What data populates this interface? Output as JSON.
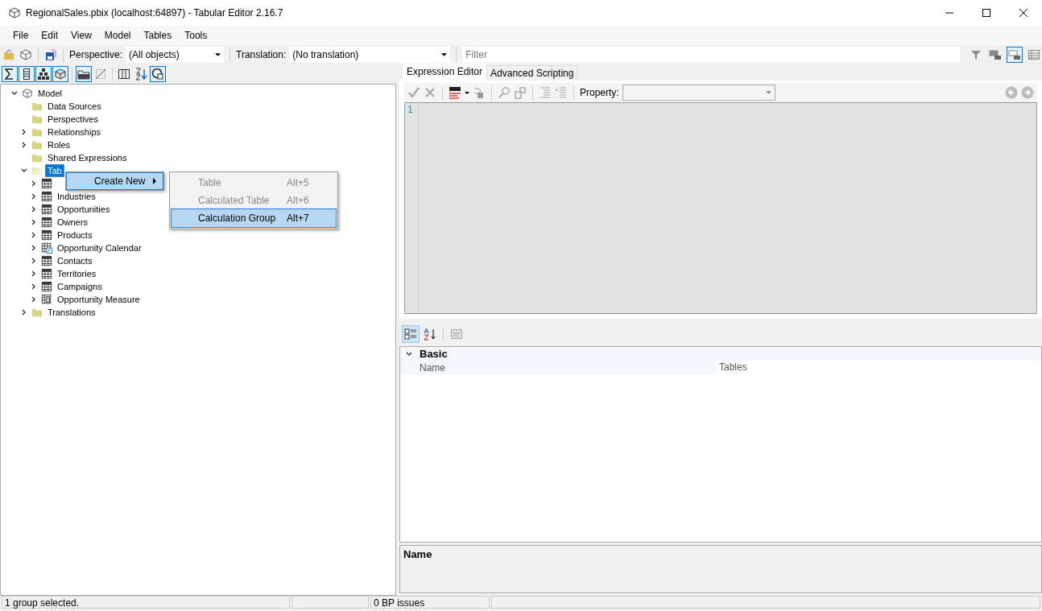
{
  "window": {
    "title": "RegionalSales.pbix (localhost:64897) - Tabular Editor 2.16.7"
  },
  "menu_bar": [
    "File",
    "Edit",
    "View",
    "Model",
    "Tables",
    "Tools"
  ],
  "toolbar": {
    "perspective_label": "Perspective:",
    "perspective": "(All objects)",
    "translation_label": "Translation:",
    "translation": "(No translation)",
    "filter": {
      "placeholder": "Filter"
    },
    "view_buttons": [
      {
        "kind": "filter",
        "selected": false
      },
      {
        "kind": "tree-grid",
        "selected": false
      },
      {
        "kind": "tree-grid",
        "selected": true
      },
      {
        "kind": "list",
        "selected": false
      }
    ]
  },
  "tree_toolbar": [
    {
      "kind": "sigma",
      "selected": true
    },
    {
      "kind": "column",
      "selected": true
    },
    {
      "kind": "hierarchy",
      "selected": true
    },
    {
      "kind": "cube",
      "selected": true
    },
    {
      "kind": "folder",
      "selected": true
    },
    {
      "kind": "hidden",
      "selected": false
    },
    {
      "kind": "columns",
      "selected": false
    },
    {
      "kind": "sort",
      "selected": false
    },
    {
      "kind": "perspective",
      "selected": true
    }
  ],
  "tree": [
    {
      "label": "Model",
      "kind": "model",
      "expanded": true,
      "selected": false,
      "children": [
        {
          "label": "Data Sources",
          "kind": "folder",
          "selected": false
        },
        {
          "label": "Perspectives",
          "kind": "folder",
          "selected": false
        },
        {
          "label": "Relationships",
          "kind": "folder",
          "expanded": false,
          "selected": false
        },
        {
          "label": "Roles",
          "kind": "folder",
          "expanded": false,
          "selected": false
        },
        {
          "label": "Shared Expressions",
          "kind": "folder",
          "selected": false
        },
        {
          "label": "Tab",
          "kind": "open-folder",
          "expanded": true,
          "selected": true,
          "children": [
            {
              "kind": "table",
              "expanded": false
            },
            {
              "label": "Industries",
              "kind": "table",
              "expanded": false,
              "selected": false
            },
            {
              "label": "Opportunities",
              "kind": "table",
              "expanded": false,
              "selected": false
            },
            {
              "label": "Owners",
              "kind": "table",
              "expanded": false,
              "selected": false
            },
            {
              "label": "Products",
              "kind": "table",
              "expanded": false,
              "selected": false
            },
            {
              "label": "Opportunity Calendar",
              "kind": "calc-table",
              "expanded": false,
              "selected": false
            },
            {
              "label": "Contacts",
              "kind": "table",
              "expanded": false,
              "selected": false
            },
            {
              "label": "Territories",
              "kind": "table",
              "expanded": false,
              "selected": false
            },
            {
              "label": "Campaigns",
              "kind": "table",
              "expanded": false,
              "selected": false
            },
            {
              "label": "Opportunity Measure",
              "kind": "measure-table",
              "expanded": false,
              "selected": false
            }
          ]
        },
        {
          "label": "Translations",
          "kind": "folder",
          "expanded": false,
          "selected": false
        }
      ]
    }
  ],
  "context_menu": {
    "items": [
      {
        "label": "Create New",
        "submenu": true,
        "selected": true
      }
    ],
    "submenu": [
      {
        "label": "Table",
        "shortcut": "Alt+5",
        "disabled": true,
        "selected": false
      },
      {
        "label": "Calculated Table",
        "shortcut": "Alt+6",
        "disabled": true,
        "selected": false
      },
      {
        "label": "Calculation Group",
        "shortcut": "Alt+7",
        "disabled": false,
        "selected": true
      }
    ]
  },
  "editor": {
    "tabs": [
      {
        "label": "Expression Editor",
        "selected": true
      },
      {
        "label": "Advanced Scripting",
        "selected": false
      }
    ],
    "property_label": "Property:",
    "line_numbers": [
      "1"
    ]
  },
  "properties": {
    "toolbar": [
      {
        "kind": "categorized",
        "selected": true
      },
      {
        "kind": "alphabetical",
        "selected": false
      },
      {
        "kind": "pages",
        "selected": false
      }
    ],
    "categories": [
      {
        "name": "Basic",
        "expanded": true,
        "rows": [
          {
            "name": "Name",
            "value": "Tables"
          }
        ]
      }
    ],
    "description_title": "Name"
  },
  "status_bar": [
    {
      "text": "1 group selected."
    },
    {
      "text": "0 BP issues"
    }
  ]
}
